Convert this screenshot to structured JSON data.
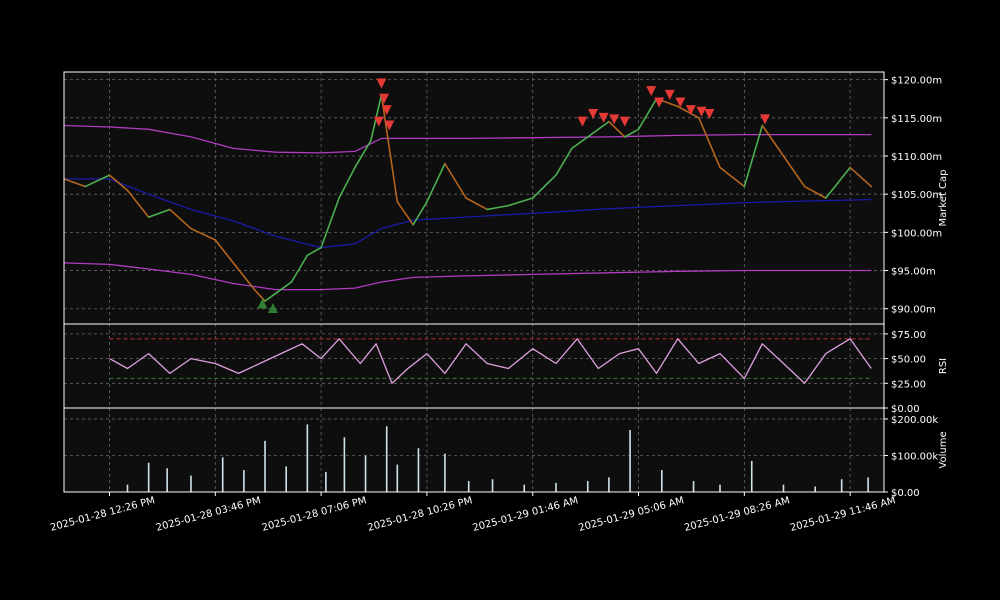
{
  "colors": {
    "background": "#000000",
    "panel": "#0e0e0e",
    "grid": "#666666",
    "border": "#ffffff",
    "candle_up": "#4caf50",
    "candle_down": "#b5651d",
    "sma": "#1a1aa8",
    "bollinger": "#b23bc2",
    "rsi_line": "#dda0dd",
    "rsi_overbought": "#c62828",
    "rsi_oversold": "#2e7d32",
    "volume_bar": "#cfe3ea",
    "sell_marker": "#e53935",
    "buy_marker": "#2e7d32"
  },
  "chart_data": [
    {
      "type": "line",
      "panel": "price",
      "ylabel": "Market Cap",
      "ylim": [
        88000000,
        121000000
      ],
      "y_ticks": [
        90000000,
        95000000,
        100000000,
        105000000,
        110000000,
        115000000,
        120000000
      ],
      "y_tick_labels": [
        "$90.00m",
        "$95.00m",
        "$100.00m",
        "$105.00m",
        "$110.00m",
        "$115.00m",
        "$120.00m"
      ],
      "grid": true,
      "x_range": [
        "2025-01-28 11:00",
        "2025-01-29 12:50"
      ],
      "series": [
        {
          "role": "market_cap",
          "x": [
            "2025-01-28 11:00",
            "2025-01-28 11:40",
            "2025-01-28 12:26",
            "2025-01-28 13:00",
            "2025-01-28 13:40",
            "2025-01-28 14:20",
            "2025-01-28 15:00",
            "2025-01-28 15:46",
            "2025-01-28 16:20",
            "2025-01-28 17:00",
            "2025-01-28 17:20",
            "2025-01-28 17:40",
            "2025-01-28 18:10",
            "2025-01-28 18:40",
            "2025-01-28 19:06",
            "2025-01-28 19:40",
            "2025-01-28 20:10",
            "2025-01-28 20:40",
            "2025-01-28 21:00",
            "2025-01-28 21:30",
            "2025-01-28 22:00",
            "2025-01-28 22:26",
            "2025-01-28 23:00",
            "2025-01-28 23:40",
            "2025-01-29 00:20",
            "2025-01-29 01:00",
            "2025-01-29 01:46",
            "2025-01-29 02:30",
            "2025-01-29 03:00",
            "2025-01-29 03:40",
            "2025-01-29 04:10",
            "2025-01-29 04:40",
            "2025-01-29 05:06",
            "2025-01-29 05:40",
            "2025-01-29 06:20",
            "2025-01-29 07:00",
            "2025-01-29 07:40",
            "2025-01-29 08:26",
            "2025-01-29 09:00",
            "2025-01-29 09:40",
            "2025-01-29 10:20",
            "2025-01-29 11:00",
            "2025-01-29 11:46",
            "2025-01-29 12:26"
          ],
          "values": [
            107000000,
            106000000,
            107500000,
            105500000,
            102000000,
            103000000,
            100500000,
            99000000,
            96000000,
            92500000,
            91000000,
            92000000,
            93500000,
            97000000,
            98000000,
            104500000,
            108500000,
            112000000,
            118000000,
            104000000,
            101000000,
            104000000,
            109000000,
            104500000,
            103000000,
            103500000,
            104500000,
            107500000,
            111000000,
            113000000,
            114500000,
            112500000,
            113500000,
            117500000,
            116500000,
            115000000,
            108500000,
            106000000,
            114000000,
            110000000,
            106000000,
            104500000,
            108500000,
            106000000
          ]
        },
        {
          "role": "moving_average",
          "x": [
            "2025-01-28 11:00",
            "2025-01-28 12:26",
            "2025-01-28 13:40",
            "2025-01-28 15:00",
            "2025-01-28 16:20",
            "2025-01-28 17:40",
            "2025-01-28 19:06",
            "2025-01-28 20:10",
            "2025-01-28 21:00",
            "2025-01-28 22:00",
            "2025-01-28 23:40",
            "2025-01-29 01:46",
            "2025-01-29 04:10",
            "2025-01-29 06:20",
            "2025-01-29 08:26",
            "2025-01-29 10:20",
            "2025-01-29 12:26"
          ],
          "values": [
            107000000,
            107000000,
            105000000,
            103000000,
            101500000,
            99500000,
            98000000,
            98500000,
            100500000,
            101600000,
            102000000,
            102500000,
            103100000,
            103500000,
            103900000,
            104100000,
            104300000
          ]
        },
        {
          "role": "upper_band",
          "x": [
            "2025-01-28 11:00",
            "2025-01-28 12:26",
            "2025-01-28 13:40",
            "2025-01-28 15:00",
            "2025-01-28 16:20",
            "2025-01-28 17:40",
            "2025-01-28 19:06",
            "2025-01-28 20:10",
            "2025-01-28 21:00",
            "2025-01-28 22:00",
            "2025-01-28 23:40",
            "2025-01-29 01:46",
            "2025-01-29 04:10",
            "2025-01-29 06:20",
            "2025-01-29 08:26",
            "2025-01-29 10:20",
            "2025-01-29 12:26"
          ],
          "values": [
            114000000,
            113800000,
            113500000,
            112500000,
            111000000,
            110500000,
            110400000,
            110600000,
            112300000,
            112300000,
            112300000,
            112400000,
            112500000,
            112700000,
            112800000,
            112800000,
            112800000
          ]
        },
        {
          "role": "lower_band",
          "x": [
            "2025-01-28 11:00",
            "2025-01-28 12:26",
            "2025-01-28 13:40",
            "2025-01-28 15:00",
            "2025-01-28 16:20",
            "2025-01-28 17:40",
            "2025-01-28 19:06",
            "2025-01-28 20:10",
            "2025-01-28 21:00",
            "2025-01-28 22:00",
            "2025-01-28 23:40",
            "2025-01-29 01:46",
            "2025-01-29 04:10",
            "2025-01-29 06:20",
            "2025-01-29 08:26",
            "2025-01-29 10:20",
            "2025-01-29 12:26"
          ],
          "values": [
            96000000,
            95800000,
            95200000,
            94500000,
            93300000,
            92500000,
            92500000,
            92700000,
            93500000,
            94100000,
            94300000,
            94500000,
            94700000,
            94900000,
            95000000,
            95000000,
            95000000
          ]
        }
      ],
      "markers": [
        {
          "kind": "sell",
          "x": "2025-01-28 21:00",
          "y": 119500000
        },
        {
          "kind": "sell",
          "x": "2025-01-28 21:05",
          "y": 117500000
        },
        {
          "kind": "sell",
          "x": "2025-01-28 21:10",
          "y": 116000000
        },
        {
          "kind": "sell",
          "x": "2025-01-28 20:55",
          "y": 114500000
        },
        {
          "kind": "sell",
          "x": "2025-01-28 21:15",
          "y": 114000000
        },
        {
          "kind": "sell",
          "x": "2025-01-29 03:20",
          "y": 114500000
        },
        {
          "kind": "sell",
          "x": "2025-01-29 03:40",
          "y": 115500000
        },
        {
          "kind": "sell",
          "x": "2025-01-29 04:00",
          "y": 115000000
        },
        {
          "kind": "sell",
          "x": "2025-01-29 04:20",
          "y": 114800000
        },
        {
          "kind": "sell",
          "x": "2025-01-29 04:40",
          "y": 114500000
        },
        {
          "kind": "sell",
          "x": "2025-01-29 05:30",
          "y": 118500000
        },
        {
          "kind": "sell",
          "x": "2025-01-29 05:45",
          "y": 117000000
        },
        {
          "kind": "sell",
          "x": "2025-01-29 06:05",
          "y": 118000000
        },
        {
          "kind": "sell",
          "x": "2025-01-29 06:25",
          "y": 117000000
        },
        {
          "kind": "sell",
          "x": "2025-01-29 06:45",
          "y": 116000000
        },
        {
          "kind": "sell",
          "x": "2025-01-29 07:05",
          "y": 115800000
        },
        {
          "kind": "sell",
          "x": "2025-01-29 07:20",
          "y": 115500000
        },
        {
          "kind": "sell",
          "x": "2025-01-29 09:05",
          "y": 114800000
        },
        {
          "kind": "buy",
          "x": "2025-01-28 17:15",
          "y": 90700000
        },
        {
          "kind": "buy",
          "x": "2025-01-28 17:35",
          "y": 90100000
        }
      ]
    },
    {
      "type": "line",
      "panel": "rsi",
      "ylabel": "RSI",
      "ylim": [
        0,
        85
      ],
      "y_ticks": [
        0,
        25,
        50,
        75
      ],
      "y_tick_labels": [
        "$0.00",
        "$25.00",
        "$50.00",
        "$75.00"
      ],
      "overbought": 70,
      "oversold": 30,
      "grid": true,
      "series": [
        {
          "role": "rsi",
          "x": [
            "2025-01-28 12:26",
            "2025-01-28 13:00",
            "2025-01-28 13:40",
            "2025-01-28 14:20",
            "2025-01-28 15:00",
            "2025-01-28 15:46",
            "2025-01-28 16:30",
            "2025-01-28 17:10",
            "2025-01-28 17:50",
            "2025-01-28 18:30",
            "2025-01-28 19:06",
            "2025-01-28 19:40",
            "2025-01-28 20:20",
            "2025-01-28 20:50",
            "2025-01-28 21:20",
            "2025-01-28 21:50",
            "2025-01-28 22:26",
            "2025-01-28 23:00",
            "2025-01-28 23:40",
            "2025-01-29 00:20",
            "2025-01-29 01:00",
            "2025-01-29 01:46",
            "2025-01-29 02:30",
            "2025-01-29 03:10",
            "2025-01-29 03:50",
            "2025-01-29 04:30",
            "2025-01-29 05:06",
            "2025-01-29 05:40",
            "2025-01-29 06:20",
            "2025-01-29 07:00",
            "2025-01-29 07:40",
            "2025-01-29 08:26",
            "2025-01-29 09:00",
            "2025-01-29 09:40",
            "2025-01-29 10:20",
            "2025-01-29 11:00",
            "2025-01-29 11:46",
            "2025-01-29 12:26"
          ],
          "values": [
            50,
            40,
            55,
            35,
            50,
            45,
            35,
            45,
            55,
            65,
            50,
            70,
            45,
            65,
            25,
            40,
            55,
            35,
            65,
            45,
            40,
            60,
            45,
            70,
            40,
            55,
            60,
            35,
            70,
            45,
            55,
            30,
            65,
            45,
            25,
            55,
            70,
            40
          ]
        }
      ]
    },
    {
      "type": "bar",
      "panel": "volume",
      "ylabel": "Volume",
      "ylim": [
        0,
        230000
      ],
      "y_ticks": [
        0,
        100000,
        200000
      ],
      "y_tick_labels": [
        "$0.00",
        "$100.00k",
        "$200.00k"
      ],
      "grid": true,
      "x_tick_labels": [
        "2025-01-28 12:26 PM",
        "2025-01-28 03:46 PM",
        "2025-01-28 07:06 PM",
        "2025-01-28 10:26 PM",
        "2025-01-29 01:46 AM",
        "2025-01-29 05:06 AM",
        "2025-01-29 08:26 AM",
        "2025-01-29 11:46 AM"
      ],
      "x_ticks": [
        "2025-01-28 12:26",
        "2025-01-28 15:46",
        "2025-01-28 19:06",
        "2025-01-28 22:26",
        "2025-01-29 01:46",
        "2025-01-29 05:06",
        "2025-01-29 08:26",
        "2025-01-29 11:46"
      ],
      "series": [
        {
          "role": "volume",
          "x": [
            "2025-01-28 13:00",
            "2025-01-28 13:40",
            "2025-01-28 14:15",
            "2025-01-28 15:00",
            "2025-01-28 16:00",
            "2025-01-28 16:40",
            "2025-01-28 17:20",
            "2025-01-28 18:00",
            "2025-01-28 18:40",
            "2025-01-28 19:15",
            "2025-01-28 19:50",
            "2025-01-28 20:30",
            "2025-01-28 21:10",
            "2025-01-28 21:30",
            "2025-01-28 22:10",
            "2025-01-28 23:00",
            "2025-01-28 23:45",
            "2025-01-29 00:30",
            "2025-01-29 01:30",
            "2025-01-29 02:30",
            "2025-01-29 03:30",
            "2025-01-29 04:10",
            "2025-01-29 04:50",
            "2025-01-29 05:50",
            "2025-01-29 06:50",
            "2025-01-29 07:40",
            "2025-01-29 08:40",
            "2025-01-29 09:40",
            "2025-01-29 10:40",
            "2025-01-29 11:30",
            "2025-01-29 12:20"
          ],
          "values": [
            20000,
            80000,
            65000,
            45000,
            95000,
            60000,
            140000,
            70000,
            185000,
            55000,
            150000,
            100000,
            180000,
            75000,
            120000,
            105000,
            30000,
            35000,
            20000,
            25000,
            30000,
            40000,
            170000,
            60000,
            30000,
            20000,
            85000,
            20000,
            15000,
            35000,
            40000
          ]
        }
      ]
    }
  ]
}
